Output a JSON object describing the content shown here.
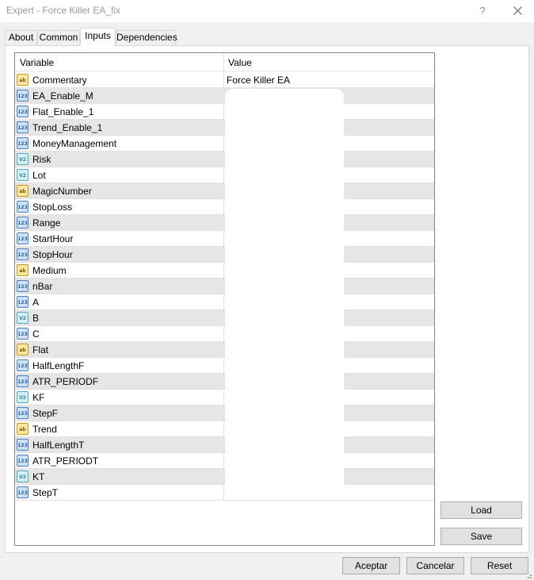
{
  "window": {
    "title": "Expert - Force Killer EA_fix",
    "help_label": "?"
  },
  "tabs": [
    "About",
    "Common",
    "Inputs",
    "Dependencies"
  ],
  "active_tab": "Inputs",
  "grid": {
    "headers": {
      "variable": "Variable",
      "value": "Value"
    },
    "rows": [
      {
        "type": "str",
        "icon": "ab",
        "variable": "Commentary",
        "value": "Force Killer EA"
      },
      {
        "type": "int",
        "icon": "123",
        "variable": "EA_Enable_M",
        "value": ""
      },
      {
        "type": "int",
        "icon": "123",
        "variable": "Flat_Enable_1",
        "value": ""
      },
      {
        "type": "int",
        "icon": "123",
        "variable": "Trend_Enable_1",
        "value": ""
      },
      {
        "type": "int",
        "icon": "123",
        "variable": "MoneyManagement",
        "value": ""
      },
      {
        "type": "dbl",
        "icon": "V2",
        "variable": "Risk",
        "value": ""
      },
      {
        "type": "dbl",
        "icon": "V2",
        "variable": "Lot",
        "value": ""
      },
      {
        "type": "str",
        "icon": "ab",
        "variable": "MagicNumber",
        "value": ""
      },
      {
        "type": "int",
        "icon": "123",
        "variable": "StopLoss",
        "value": ""
      },
      {
        "type": "int",
        "icon": "123",
        "variable": "Range",
        "value": ""
      },
      {
        "type": "int",
        "icon": "123",
        "variable": "StartHour",
        "value": ""
      },
      {
        "type": "int",
        "icon": "123",
        "variable": "StopHour",
        "value": ""
      },
      {
        "type": "str",
        "icon": "ab",
        "variable": "Medium",
        "value": ""
      },
      {
        "type": "int",
        "icon": "123",
        "variable": "nBar",
        "value": ""
      },
      {
        "type": "int",
        "icon": "123",
        "variable": "A",
        "value": ""
      },
      {
        "type": "dbl",
        "icon": "V2",
        "variable": "B",
        "value": ""
      },
      {
        "type": "int",
        "icon": "123",
        "variable": "C",
        "value": ""
      },
      {
        "type": "str",
        "icon": "ab",
        "variable": "Flat",
        "value": ""
      },
      {
        "type": "int",
        "icon": "123",
        "variable": "HalfLengthF",
        "value": ""
      },
      {
        "type": "int",
        "icon": "123",
        "variable": "ATR_PERIODF",
        "value": ""
      },
      {
        "type": "dbl",
        "icon": "V2",
        "variable": "KF",
        "value": ""
      },
      {
        "type": "int",
        "icon": "123",
        "variable": "StepF",
        "value": ""
      },
      {
        "type": "str",
        "icon": "ab",
        "variable": "Trend",
        "value": ""
      },
      {
        "type": "int",
        "icon": "123",
        "variable": "HalfLengthT",
        "value": ""
      },
      {
        "type": "int",
        "icon": "123",
        "variable": "ATR_PERIODT",
        "value": ""
      },
      {
        "type": "dbl",
        "icon": "V2",
        "variable": "KT",
        "value": ""
      },
      {
        "type": "int",
        "icon": "123",
        "variable": "StepT",
        "value": ""
      }
    ]
  },
  "side_buttons": {
    "load": "Load",
    "save": "Save"
  },
  "bottom_buttons": {
    "ok": "Aceptar",
    "cancel": "Cancelar",
    "reset": "Reset"
  },
  "colors": {
    "alt_row": "#e6e6e6",
    "button_bg": "#e1e1e1",
    "title_text": "#9a9a9a"
  }
}
